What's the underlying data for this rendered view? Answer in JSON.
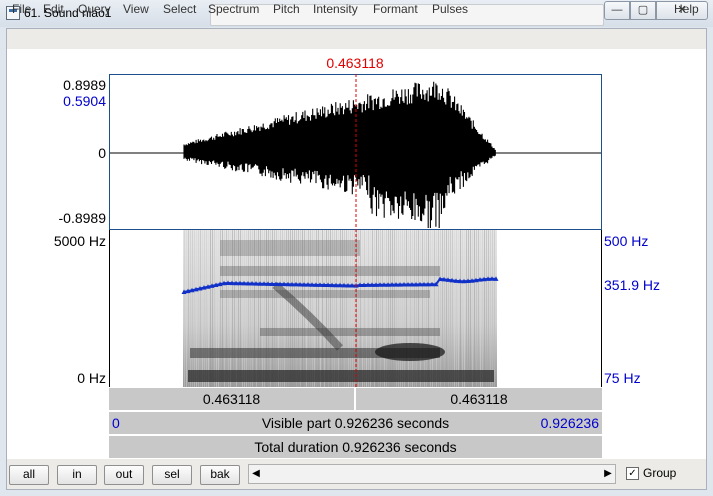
{
  "window": {
    "title": "61. Sound niao1",
    "min": "—",
    "max": "▢",
    "close": "✕"
  },
  "menu": [
    "File",
    "Edit",
    "Query",
    "View",
    "Select",
    "Spectrum",
    "Pitch",
    "Intensity",
    "Formant",
    "Pulses",
    "Help"
  ],
  "cursor_time": "0.463118",
  "waveform": {
    "y_top": "0.8989",
    "y_sel": "0.5904",
    "y_mid": "0",
    "y_bottom": "-0.8989"
  },
  "spectrogram": {
    "freq_top": "5000 Hz",
    "freq_bottom": "0 Hz",
    "pitch_top": "500 Hz",
    "pitch_cursor": "351.9 Hz",
    "pitch_bottom": "75 Hz"
  },
  "time_bars": {
    "left_half": "0.463118",
    "right_half": "0.463118",
    "visible_start": "0",
    "visible_text": "Visible part 0.926236 seconds",
    "visible_end": "0.926236",
    "total_text": "Total duration 0.926236 seconds"
  },
  "buttons": [
    "all",
    "in",
    "out",
    "sel",
    "bak"
  ],
  "scroll": {
    "left_arrow": "◀",
    "right_arrow": "▶"
  },
  "group": {
    "label": "Group",
    "checked": true,
    "mark": "✓"
  },
  "colors": {
    "cursor": "#e00000",
    "pitch": "#1030c8",
    "axis_blue": "#0000cc"
  }
}
